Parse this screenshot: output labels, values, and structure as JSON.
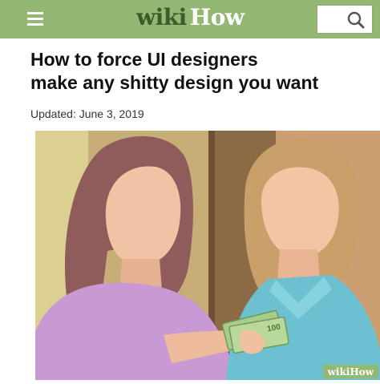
{
  "header": {
    "logo_wiki": "wiki",
    "logo_how": "How",
    "menu_icon": "hamburger-menu-icon",
    "search_icon": "search-icon",
    "brand_color": "#93b874"
  },
  "article": {
    "title_line1": "How to force UI designers",
    "title_line2": "make any shitty design you want",
    "updated": "Updated: June 3, 2019"
  },
  "illustration": {
    "banknote_value": "100",
    "watermark": "wikiHow"
  }
}
